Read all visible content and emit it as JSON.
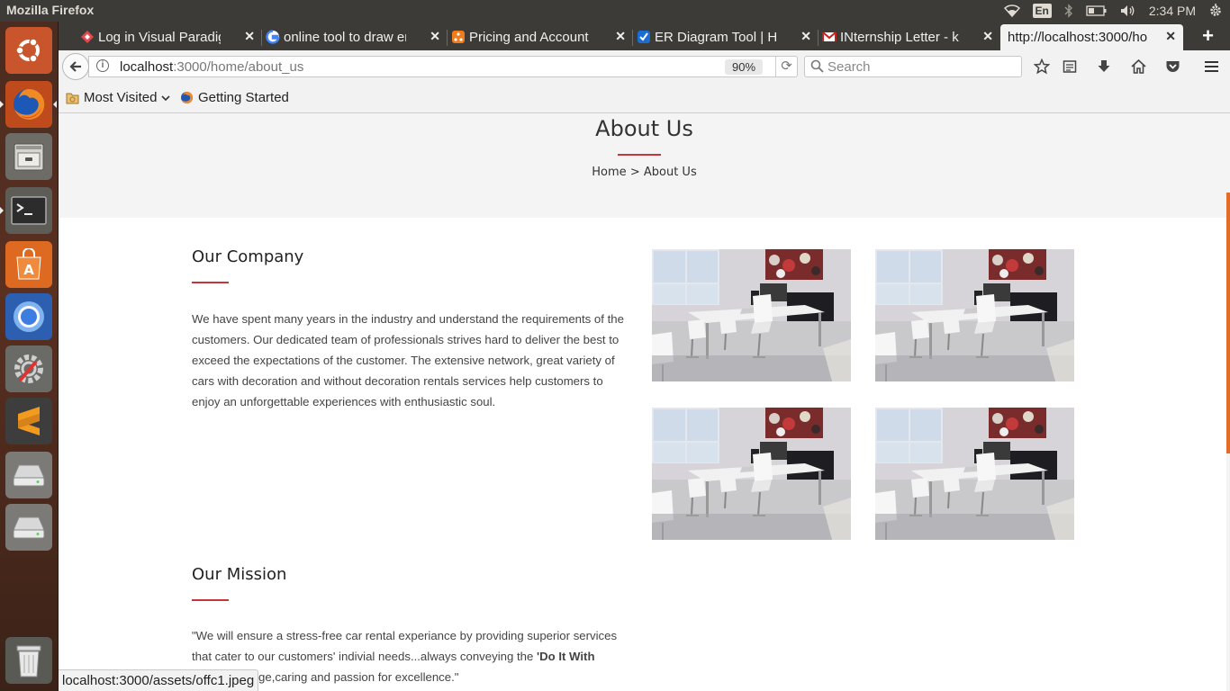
{
  "panel": {
    "app_name": "Mozilla Firefox",
    "keyboard_layout": "En",
    "time": "2:34 PM"
  },
  "launcher": {
    "items": [
      "ubuntu-dash-icon",
      "firefox-icon",
      "files-icon",
      "terminal-icon",
      "software-center-icon",
      "chromium-icon",
      "settings-icon",
      "sublime-text-icon",
      "disk-icon",
      "disk-icon",
      "trash-icon"
    ]
  },
  "tabs": [
    {
      "title": "Log in Visual Paradigm",
      "favicon_color": "#e5484d"
    },
    {
      "title": "online tool to draw er",
      "favicon_color": "#4285f4"
    },
    {
      "title": "Pricing and Account T",
      "favicon_color": "#f07c1b"
    },
    {
      "title": "ER Diagram Tool | How",
      "favicon_color": "#1c6dd0"
    },
    {
      "title": "INternship Letter - kor",
      "favicon_color": "#c5221f"
    },
    {
      "title": "http://localhost:3000/ho",
      "favicon_color": ""
    }
  ],
  "navbar": {
    "url_host": "localhost",
    "url_rest": ":3000/home/about_us",
    "zoom": "90%",
    "search_placeholder": "Search"
  },
  "bookmarks": {
    "most_visited": "Most Visited",
    "getting_started": "Getting Started"
  },
  "page": {
    "hero_title": "About Us",
    "breadcrumb_home": "Home",
    "breadcrumb_separator": ">",
    "breadcrumb_current": "About Us",
    "company": {
      "title": "Our Company",
      "text": "We have spent many years in the industry and understand the requirements of the customers. Our dedicated team of professionals strives hard to deliver the best to exceed the expectations of the customer. The extensive network, great variety of cars with decoration and without decoration rentals services help customers to enjoy an unforgettable experiences with enthusiastic soul."
    },
    "mission": {
      "title": "Our Mission",
      "text_before": "\"We will ensure a stress-free car rental experiance by providing superior services that cater to our customers' indivial needs...always conveying the ",
      "text_bold": "'Do It With",
      "text_after": " ...th knowledge,caring and passion for excellence.\""
    },
    "gallery_image_count": 4
  },
  "status_url": "localhost:3000/assets/offc1.jpeg",
  "colors": {
    "accent_red": "#c8343c",
    "launcher_bg": "#4a2c20",
    "scroll_thumb": "#e36d28"
  }
}
